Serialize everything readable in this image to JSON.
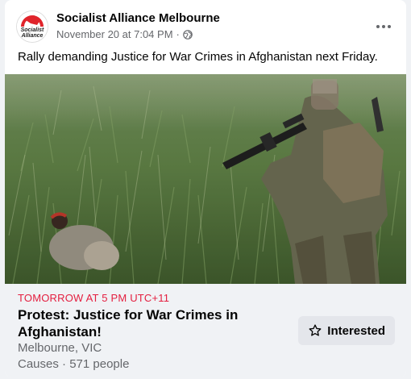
{
  "post": {
    "page_name": "Socialist Alliance Melbourne",
    "date": "November 20 at 7:04 PM",
    "separator": "·",
    "privacy_icon": "globe-icon",
    "more_icon": "more-options-icon",
    "text": "Rally demanding Justice for War Crimes in Afghanistan next Friday.",
    "logo_text": [
      "Socialist",
      "Alliance"
    ]
  },
  "event": {
    "date_label": "TOMORROW AT 5 PM UTC+11",
    "title": "Protest: Justice for War Crimes in Afghanistan!",
    "location": "Melbourne, VIC",
    "category_people": "Causes · 571 people",
    "interested_label": "Interested",
    "interested_icon": "star-icon"
  },
  "colors": {
    "date_red": "#e41e3f",
    "logo_red": "#e0242b",
    "button_bg": "#e4e6eb"
  }
}
